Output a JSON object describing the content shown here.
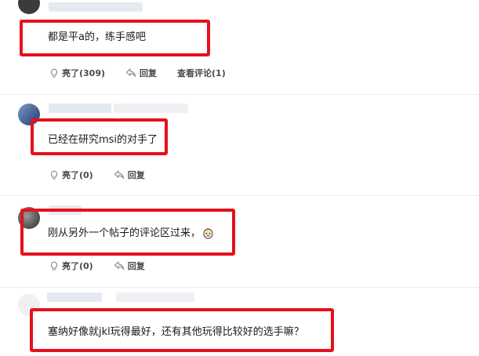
{
  "comments": [
    {
      "text": "都是平a的，练手感吧",
      "like_label": "亮了(309)",
      "reply_label": "回复",
      "view_replies_label": "查看评论(1)"
    },
    {
      "text": "已经在研究msi的对手了",
      "like_label": "亮了(0)",
      "reply_label": "回复"
    },
    {
      "text": "刚从另外一个帖子的评论区过来，",
      "emoji": "crying-face-emoji",
      "like_label": "亮了(0)",
      "reply_label": "回复"
    },
    {
      "text": "塞纳好像就jkl玩得最好，还有其他玩得比较好的选手嘛？"
    }
  ],
  "colors": {
    "highlight_box": "#e5111d",
    "action_text": "#555555",
    "separator": "#ececec"
  }
}
